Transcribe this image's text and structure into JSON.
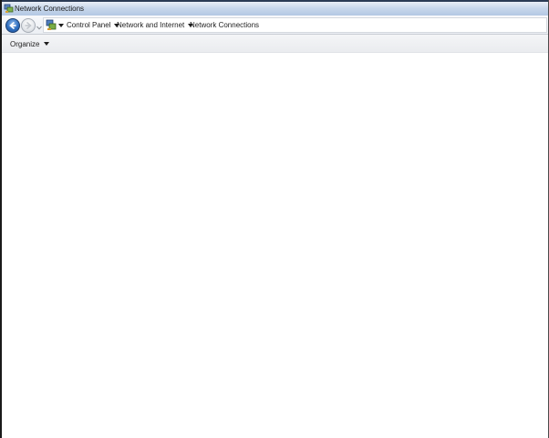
{
  "window": {
    "title": "Network Connections",
    "icon": "network-connections-icon"
  },
  "navigation": {
    "back_icon": "back-arrow-icon",
    "forward_icon": "forward-arrow-icon",
    "history_icon": "chevron-down-icon",
    "address_icon": "control-panel-icon",
    "breadcrumbs": [
      {
        "label": "Control Panel"
      },
      {
        "label": "Network and Internet"
      },
      {
        "label": "Network Connections"
      }
    ]
  },
  "command_bar": {
    "organize_label": "Organize"
  },
  "colors": {
    "title_bar": "#c9d8ec",
    "back_button": "#2f6fc0",
    "content_background": "#ffffff"
  }
}
